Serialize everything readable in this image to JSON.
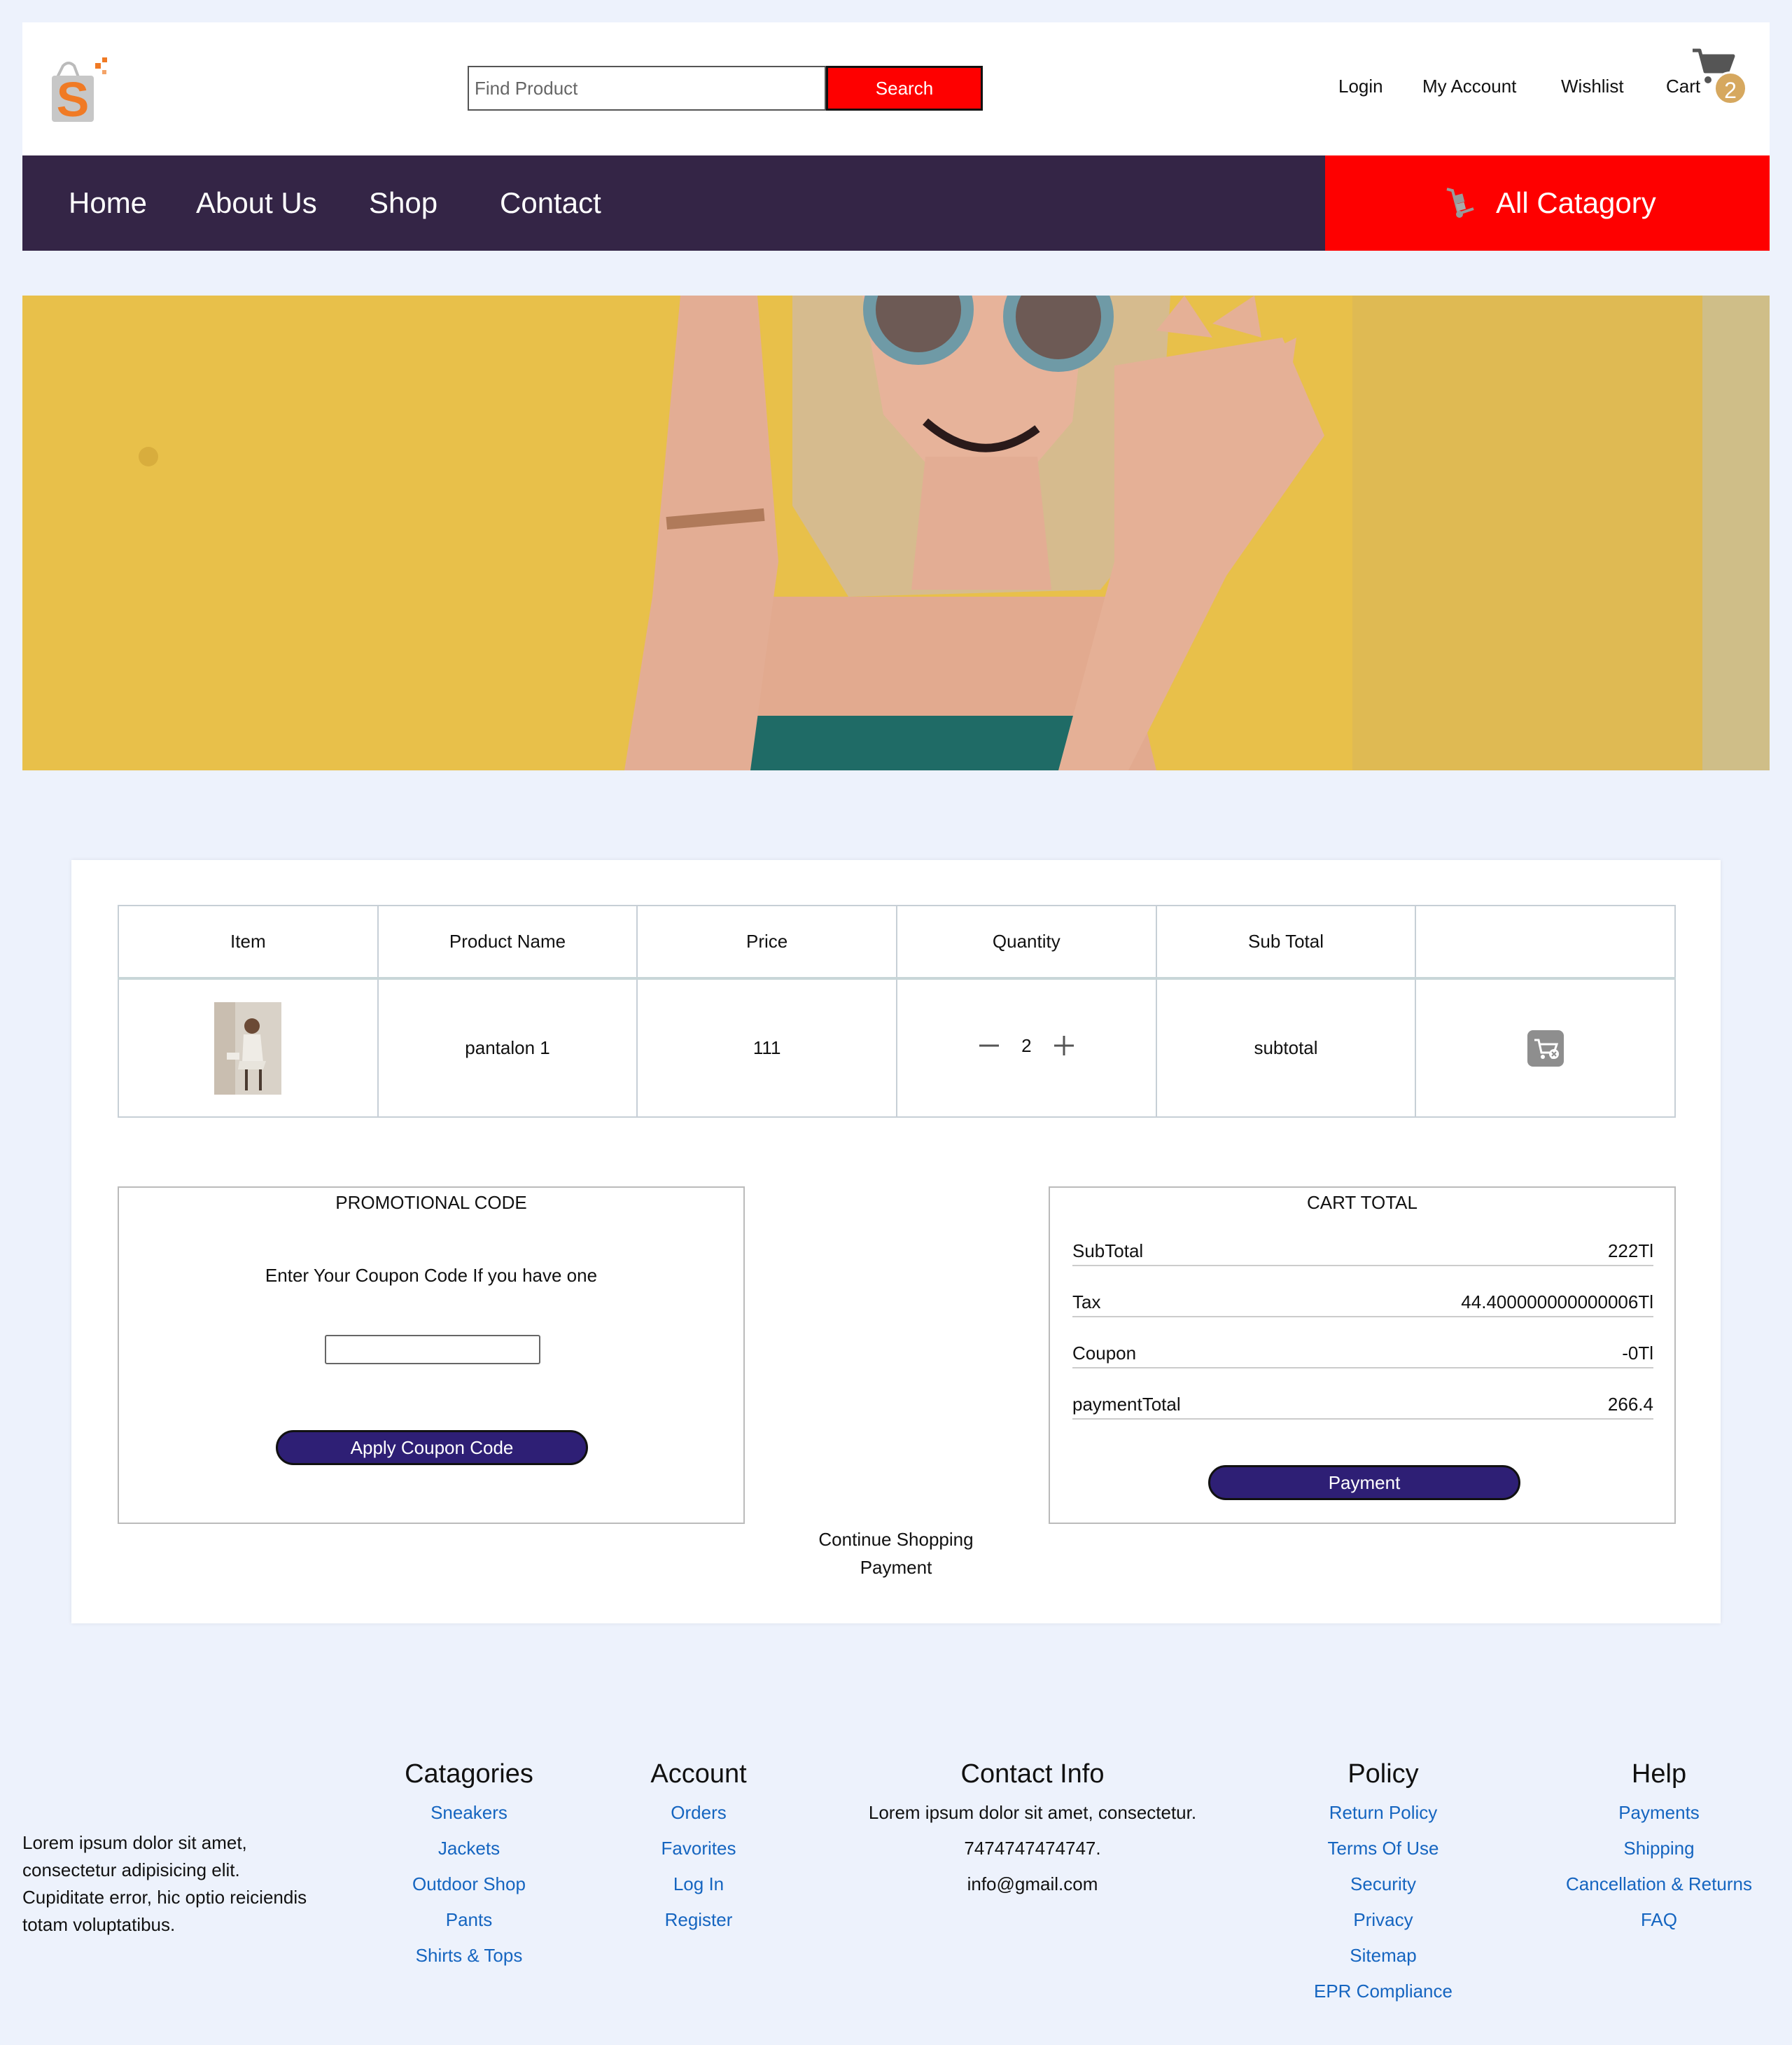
{
  "header": {
    "search_placeholder": "Find Product",
    "search_button": "Search",
    "links": [
      "Login",
      "My Account",
      "Wishlist",
      "Cart"
    ],
    "cart_count": "2"
  },
  "nav": {
    "items": [
      "Home",
      "About Us",
      "Shop",
      "Contact"
    ],
    "all_category": "All Catagory"
  },
  "cart": {
    "columns": [
      "Item",
      "Product Name",
      "Price",
      "Quantity",
      "Sub Total",
      ""
    ],
    "rows": [
      {
        "product_name": "pantalon 1",
        "price": "111",
        "quantity": "2",
        "subtotal": "subtotal"
      }
    ]
  },
  "promo": {
    "title": "PROMOTIONAL CODE",
    "description": "Enter Your Coupon Code If you have one",
    "input_value": "",
    "button": "Apply Coupon Code"
  },
  "cart_total": {
    "title": "CART TOTAL",
    "rows": [
      {
        "label": "SubTotal",
        "value": "222Tl"
      },
      {
        "label": "Tax",
        "value": "44.400000000000006Tl"
      },
      {
        "label": "Coupon",
        "value": "-0Tl"
      },
      {
        "label": "paymentTotal",
        "value": "266.4"
      }
    ],
    "button": "Payment"
  },
  "continue_links": [
    "Continue Shopping",
    "Payment"
  ],
  "footer": {
    "about": "Lorem ipsum dolor sit amet, consectetur adipisicing elit. Cupiditate error, hic optio reiciendis totam voluptatibus.",
    "categories": {
      "title": "Catagories",
      "links": [
        "Sneakers",
        "Jackets",
        "Outdoor Shop",
        "Pants",
        "Shirts & Tops"
      ]
    },
    "account": {
      "title": "Account",
      "links": [
        "Orders",
        "Favorites",
        "Log In",
        "Register"
      ]
    },
    "contact": {
      "title": "Contact Info",
      "lines": [
        "Lorem ipsum dolor sit amet, consectetur.",
        "7474747474747.",
        "info@gmail.com"
      ]
    },
    "policy": {
      "title": "Policy",
      "links": [
        "Return Policy",
        "Terms Of Use",
        "Security",
        "Privacy",
        "Sitemap",
        "EPR Compliance"
      ]
    },
    "help": {
      "title": "Help",
      "links": [
        "Payments",
        "Shipping",
        "Cancellation & Returns",
        "FAQ"
      ]
    }
  },
  "colors": {
    "nav_bg": "#342546",
    "accent_red": "#fe0000",
    "button_purple": "#2e1f75",
    "link_blue": "#1565c0",
    "page_bg": "#edf2fc"
  }
}
